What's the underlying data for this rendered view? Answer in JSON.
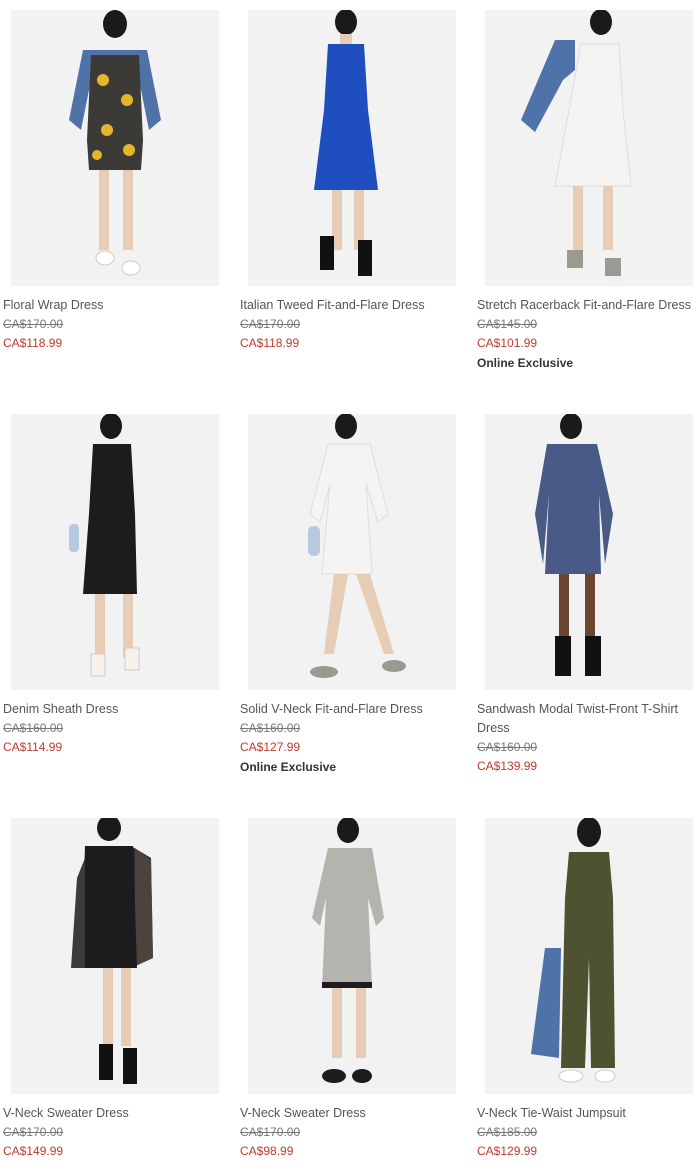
{
  "products": [
    {
      "name": "Floral Wrap Dress",
      "was": "CA$170.00",
      "now": "CA$118.99",
      "badge": ""
    },
    {
      "name": "Italian Tweed Fit-and-Flare Dress",
      "was": "CA$170.00",
      "now": "CA$118.99",
      "badge": ""
    },
    {
      "name": "Stretch Racerback Fit-and-Flare Dress",
      "was": "CA$145.00",
      "now": "CA$101.99",
      "badge": "Online Exclusive"
    },
    {
      "name": "Denim Sheath Dress",
      "was": "CA$160.00",
      "now": "CA$114.99",
      "badge": ""
    },
    {
      "name": "Solid V-Neck Fit-and-Flare Dress",
      "was": "CA$160.00",
      "now": "CA$127.99",
      "badge": "Online Exclusive"
    },
    {
      "name": "Sandwash Modal Twist-Front T-Shirt Dress",
      "was": "CA$160.00",
      "now": "CA$139.99",
      "badge": ""
    },
    {
      "name": "V-Neck Sweater Dress",
      "was": "CA$170.00",
      "now": "CA$149.99",
      "badge": ""
    },
    {
      "name": "V-Neck Sweater Dress",
      "was": "CA$170.00",
      "now": "CA$98.99",
      "badge": ""
    },
    {
      "name": "V-Neck Tie-Waist Jumpsuit",
      "was": "CA$185.00",
      "now": "CA$129.99",
      "badge": ""
    }
  ],
  "colors": {
    "sale": "#c0392b",
    "image_bg": "#f2f2f2",
    "dress_floral": "#3b3a36",
    "dress_blue": "#1f4fbf",
    "dress_white": "#f4f4f2",
    "dress_black": "#1c1c1e",
    "dress_slate": "#4a5a86",
    "dress_gray": "#b5b3ad",
    "jumpsuit_olive": "#4f5230",
    "denim": "#4f72a8"
  }
}
